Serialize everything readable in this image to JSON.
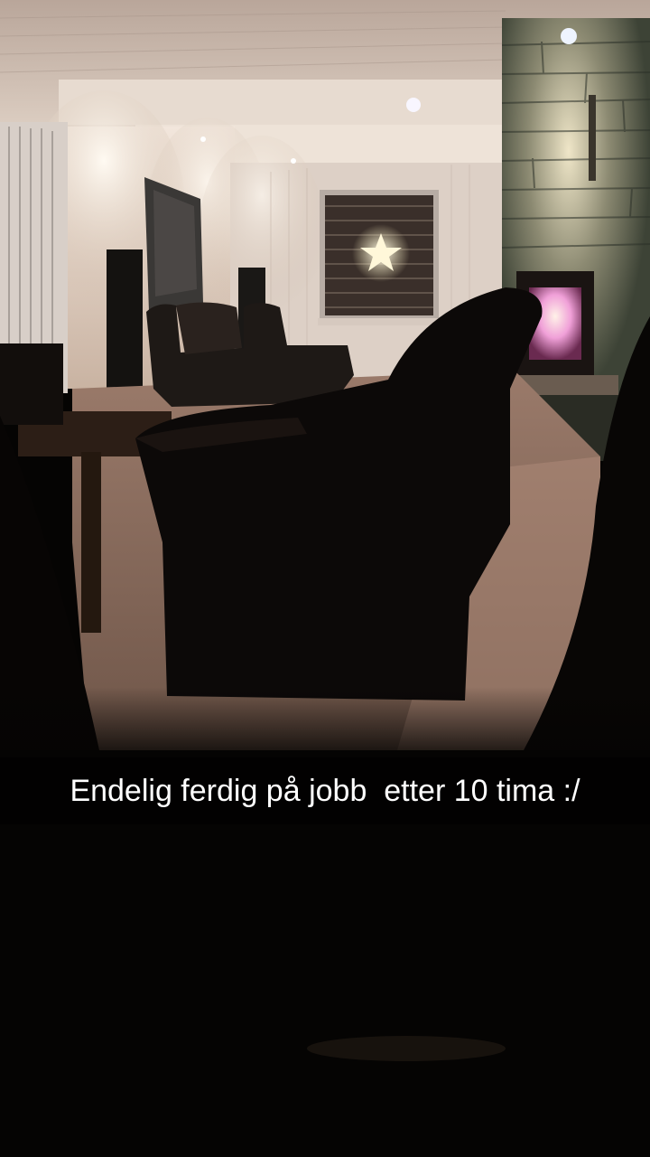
{
  "scene": {
    "subject": "dim living room at night with recliner sofa, armchair, window with lit star, and fireplace",
    "icons": [
      "star-light",
      "fireplace-fire",
      "ceiling-spotlight"
    ]
  },
  "caption": {
    "text": "Endelig ferdig på jobb  etter 10 tima :/"
  },
  "colors": {
    "caption_bar": "#000000",
    "caption_text": "#ffffff",
    "fire_glow": "#e9a7e6",
    "wall_light": "#f0dfd0"
  }
}
